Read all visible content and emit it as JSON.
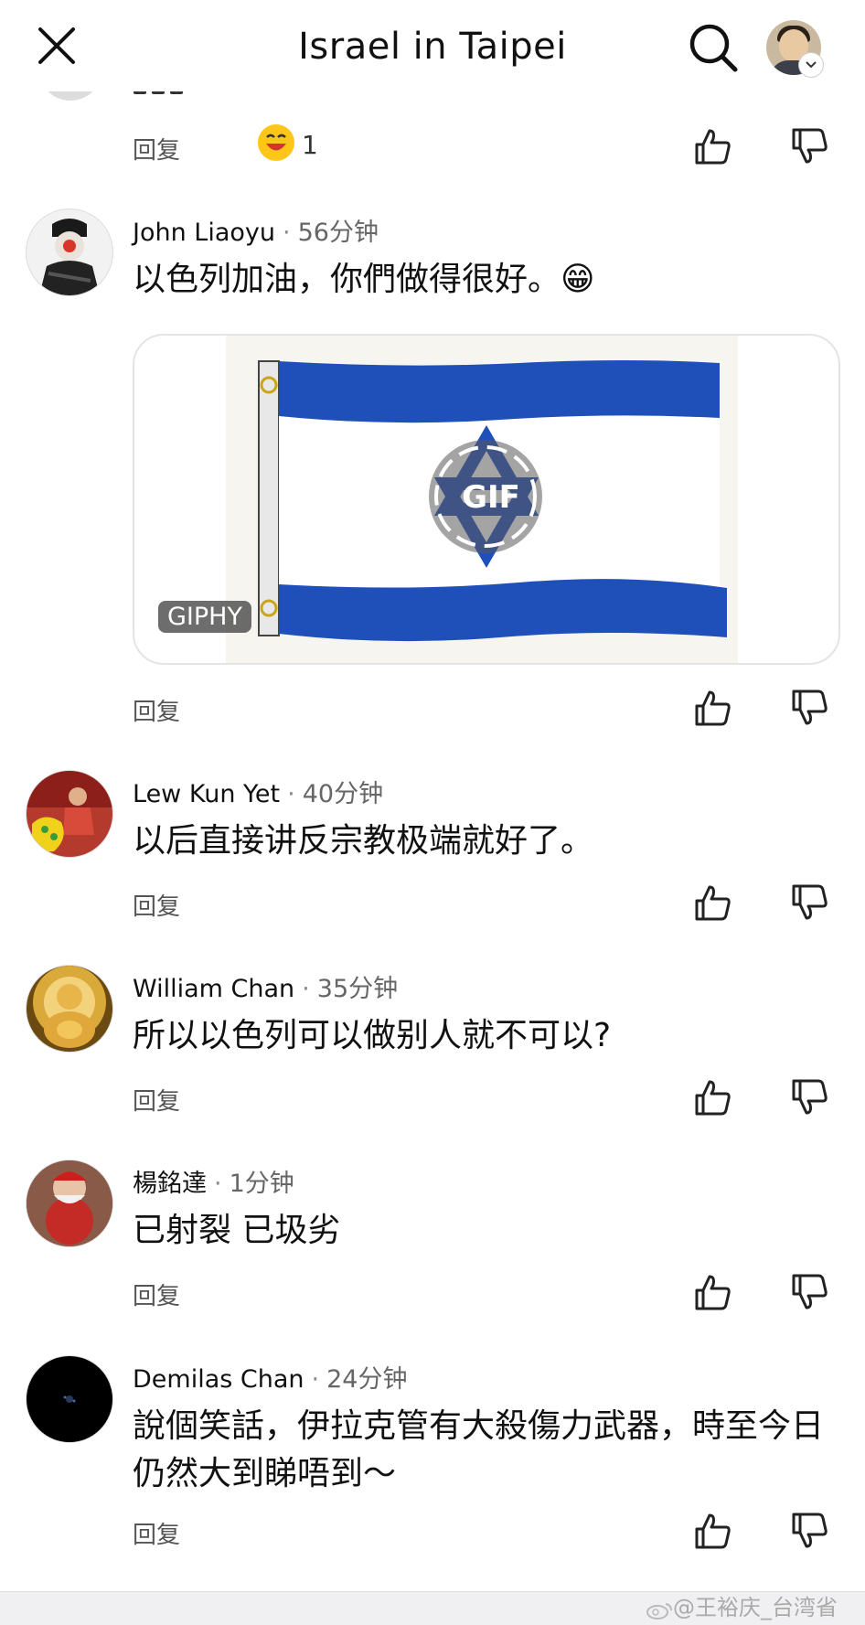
{
  "header": {
    "title": "Israel in Taipei",
    "close_icon": "close-icon",
    "search_icon": "search-icon"
  },
  "reply_label": "回复",
  "top_action": {
    "reaction_count": "1"
  },
  "comments": [
    {
      "name": "John Liaoyu",
      "time": "56分钟",
      "text": "以色列加油，你們做得很好。😁"
    },
    {
      "name": "Lew Kun Yet",
      "time": "40分钟",
      "text": "以后直接讲反宗教极端就好了。"
    },
    {
      "name": "William Chan",
      "time": "35分钟",
      "text": "所以以色列可以做别人就不可以?"
    },
    {
      "name": "楊銘達",
      "time": "1分钟",
      "text": "已射裂 已圾劣"
    },
    {
      "name": "Demilas Chan",
      "time": "24分钟",
      "text": "說個笑話，伊拉克管有大殺傷力武器，時至今日仍然大到睇唔到～"
    }
  ],
  "gif": {
    "provider": "GIPHY",
    "badge": "GIF"
  },
  "watermark": "@王裕庆_台湾省",
  "colors": {
    "flag_blue": "#1f4fb8",
    "reply_gray": "#555555"
  }
}
